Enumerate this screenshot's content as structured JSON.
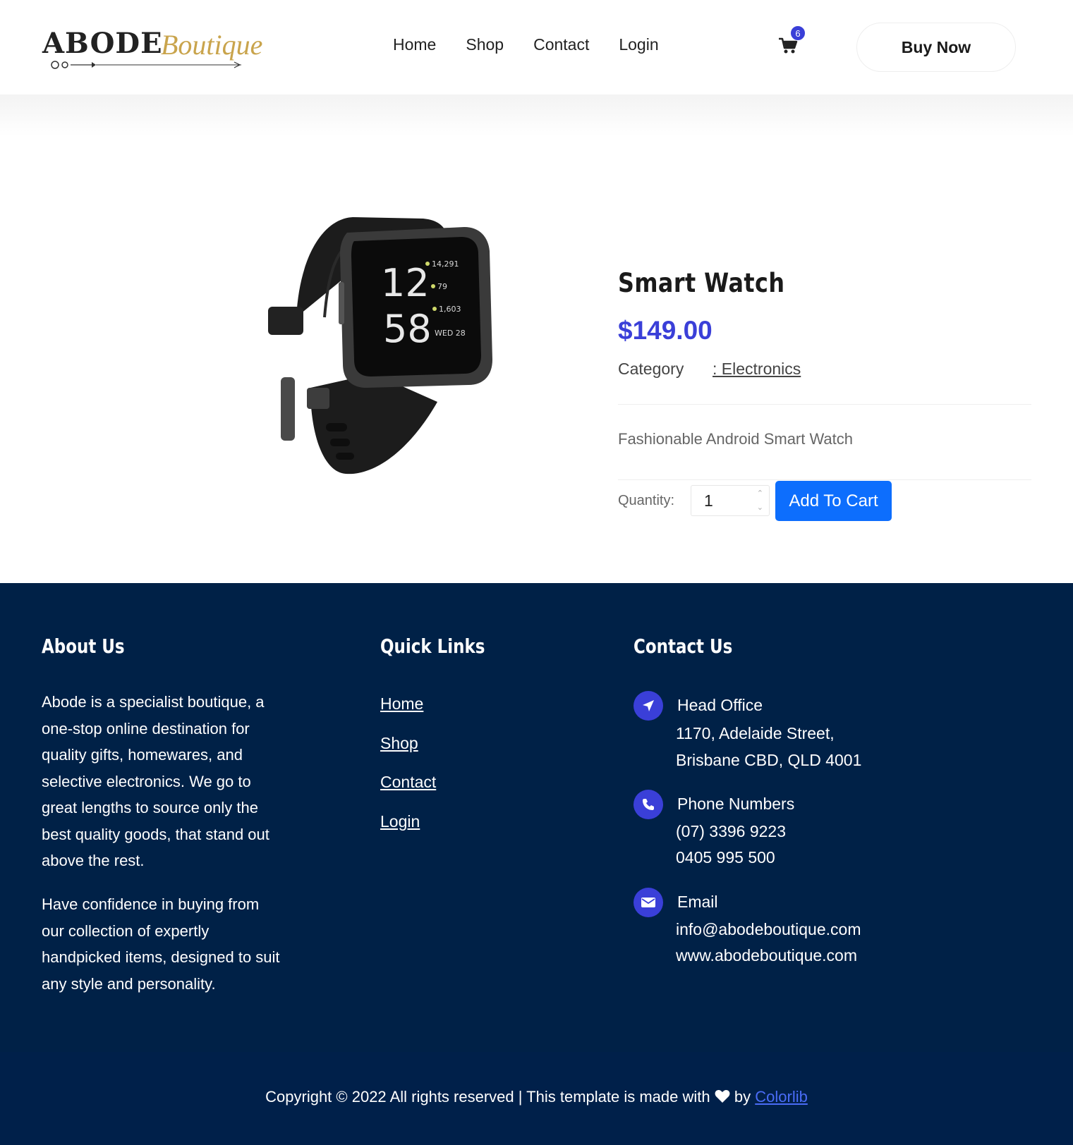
{
  "header": {
    "logo_main": "ABODE",
    "logo_script": "Boutique",
    "nav": [
      "Home",
      "Shop",
      "Contact",
      "Login"
    ],
    "cart_count": "6",
    "buy_now": "Buy Now"
  },
  "product": {
    "title": "Smart Watch",
    "price": "$149.00",
    "category_label": "Category",
    "category_value": ": Electronics",
    "description": "Fashionable Android Smart Watch",
    "quantity_label": "Quantity:",
    "quantity_value": "1",
    "add_to_cart": "Add To Cart",
    "watch_face": {
      "hour": "12",
      "minute": "58",
      "steps": "14,291",
      "heart": "79",
      "cal": "1,603",
      "date": "WED 28"
    }
  },
  "footer": {
    "about": {
      "heading": "About Us",
      "p1": "Abode is a specialist boutique, a one-stop online destination for quality gifts, homewares, and selective electronics. We go to great lengths to source only the best quality goods, that stand out above the rest.",
      "p2": "Have confidence in buying from our collection of expertly handpicked items, designed to suit any style and personality."
    },
    "quick_links": {
      "heading": "Quick Links",
      "links": [
        "Home",
        "Shop",
        "Contact",
        "Login"
      ]
    },
    "contact": {
      "heading": "Contact Us",
      "office_title": "Head Office",
      "office_line1": "1170, Adelaide Street,",
      "office_line2": "Brisbane CBD, QLD 4001",
      "phone_title": "Phone Numbers",
      "phone1": "(07) 3396 9223",
      "phone2": "0405 995 500",
      "email_title": "Email",
      "email": "info@abodeboutique.com",
      "website": "www.abodeboutique.com"
    },
    "copyright_before": "Copyright © 2022 All rights reserved | This template is made with",
    "copyright_by": "by",
    "copyright_link": "Colorlib"
  },
  "colors": {
    "accent": "#3a3fd8",
    "button_blue": "#0d6efd",
    "footer_bg": "#002147",
    "logo_gold": "#c9a44c"
  },
  "icons": [
    "cart-icon",
    "location-arrow-icon",
    "phone-icon",
    "envelope-icon",
    "heart-icon"
  ]
}
